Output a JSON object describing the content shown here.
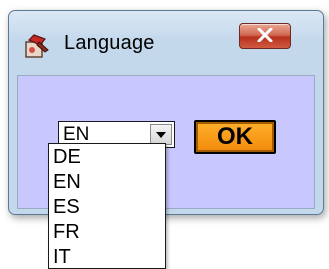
{
  "window": {
    "title": "Language",
    "close_symbol": "X"
  },
  "icons": {
    "app": "language-app-icon",
    "close": "close-icon",
    "dropdown_arrow": "chevron-down-icon"
  },
  "combo": {
    "selected": "EN"
  },
  "dropdown": {
    "options": [
      "DE",
      "EN",
      "ES",
      "FR",
      "IT"
    ]
  },
  "ok_button": {
    "label": "OK"
  },
  "colors": {
    "client_background": "#c8c8ff",
    "ok_button": "#f59a16",
    "close_button": "#c9452b"
  }
}
